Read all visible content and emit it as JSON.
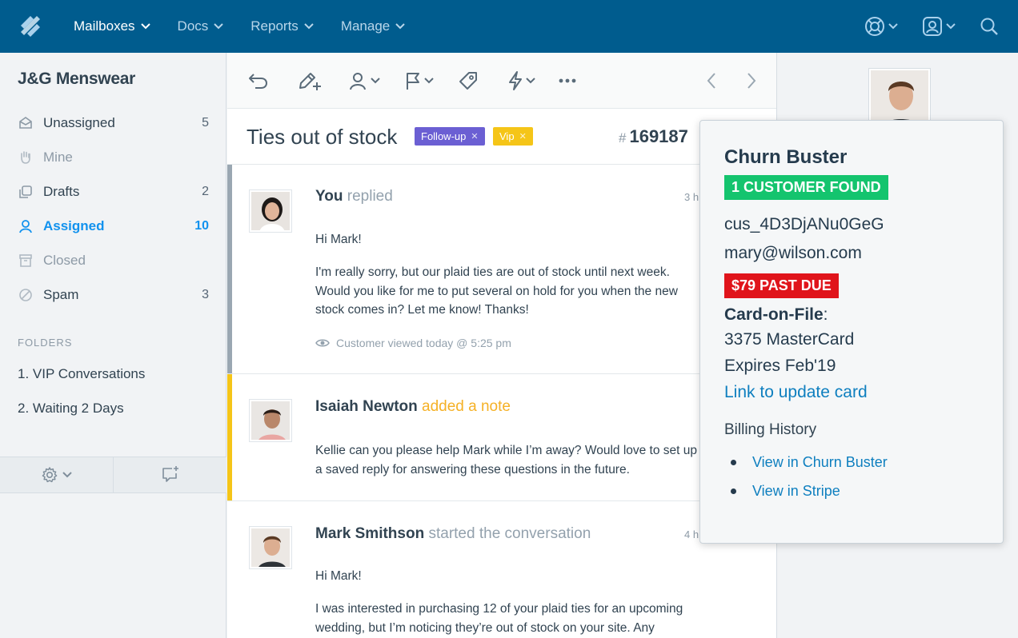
{
  "nav": {
    "items": [
      {
        "label": "Mailboxes",
        "active": true
      },
      {
        "label": "Docs",
        "active": false
      },
      {
        "label": "Reports",
        "active": false
      },
      {
        "label": "Manage",
        "active": false
      }
    ]
  },
  "sidebar": {
    "mailbox_name": "J&G Menswear",
    "folders": [
      {
        "label": "Unassigned",
        "count": "5",
        "icon": "inbox-icon"
      },
      {
        "label": "Mine",
        "count": "",
        "icon": "hand-icon"
      },
      {
        "label": "Drafts",
        "count": "2",
        "icon": "drafts-icon"
      },
      {
        "label": "Assigned",
        "count": "10",
        "icon": "person-icon"
      },
      {
        "label": "Closed",
        "count": "",
        "icon": "archive-icon"
      },
      {
        "label": "Spam",
        "count": "3",
        "icon": "block-icon"
      }
    ],
    "folders_heading": "FOLDERS",
    "custom_folders": [
      "1. VIP Conversations",
      "2. Waiting 2 Days"
    ]
  },
  "conversation": {
    "subject": "Ties out of stock",
    "tags": [
      {
        "label": "Follow-up",
        "color": "#6b5fd3"
      },
      {
        "label": "Vip",
        "color": "#f5c518"
      }
    ],
    "ticket_hash": "#",
    "ticket_number": "169187",
    "threads": [
      {
        "who": "You",
        "action": "replied",
        "time": "3 h",
        "bar_color": "#9aa7b2",
        "body": [
          "Hi Mark!",
          "I'm really sorry, but our plaid ties are out of stock until next week. Would you like for me to put several on hold for you when the new stock comes in? Let me know! Thanks!"
        ],
        "viewed": "Customer viewed today @ 5:25 pm"
      },
      {
        "who": "Isaiah Newton",
        "action": "added a note",
        "time": "",
        "bar_color": "#f5c518",
        "body": [
          "Kellie can you please help Mark while I’m away? Would love to set up a saved reply for answering these questions in the future."
        ]
      },
      {
        "who": "Mark Smithson",
        "action": "started the conversation",
        "time": "4 h",
        "bar_color": "#ffffff",
        "body": [
          "Hi Mark!",
          "I was interested in purchasing 12 of your plaid ties for an upcoming wedding, but I’m noticing they’re out of stock on your site. Any"
        ]
      }
    ]
  },
  "popover": {
    "title": "Churn Buster",
    "customer_found": "1 CUSTOMER FOUND",
    "customer_id": "cus_4D3DjANu0GeG",
    "email": "mary@wilson.com",
    "past_due": "$79 PAST DUE",
    "card_label": "Card-on-File",
    "card_colon": ":",
    "card_number": "3375 MasterCard",
    "card_expiry": "Expires Feb'19",
    "update_link": "Link to update card",
    "billing_heading": "Billing History",
    "billing_links": [
      "View in Churn Buster",
      "View in Stripe"
    ],
    "colors": {
      "found": "#14c46e",
      "past_due": "#e0141b"
    }
  }
}
